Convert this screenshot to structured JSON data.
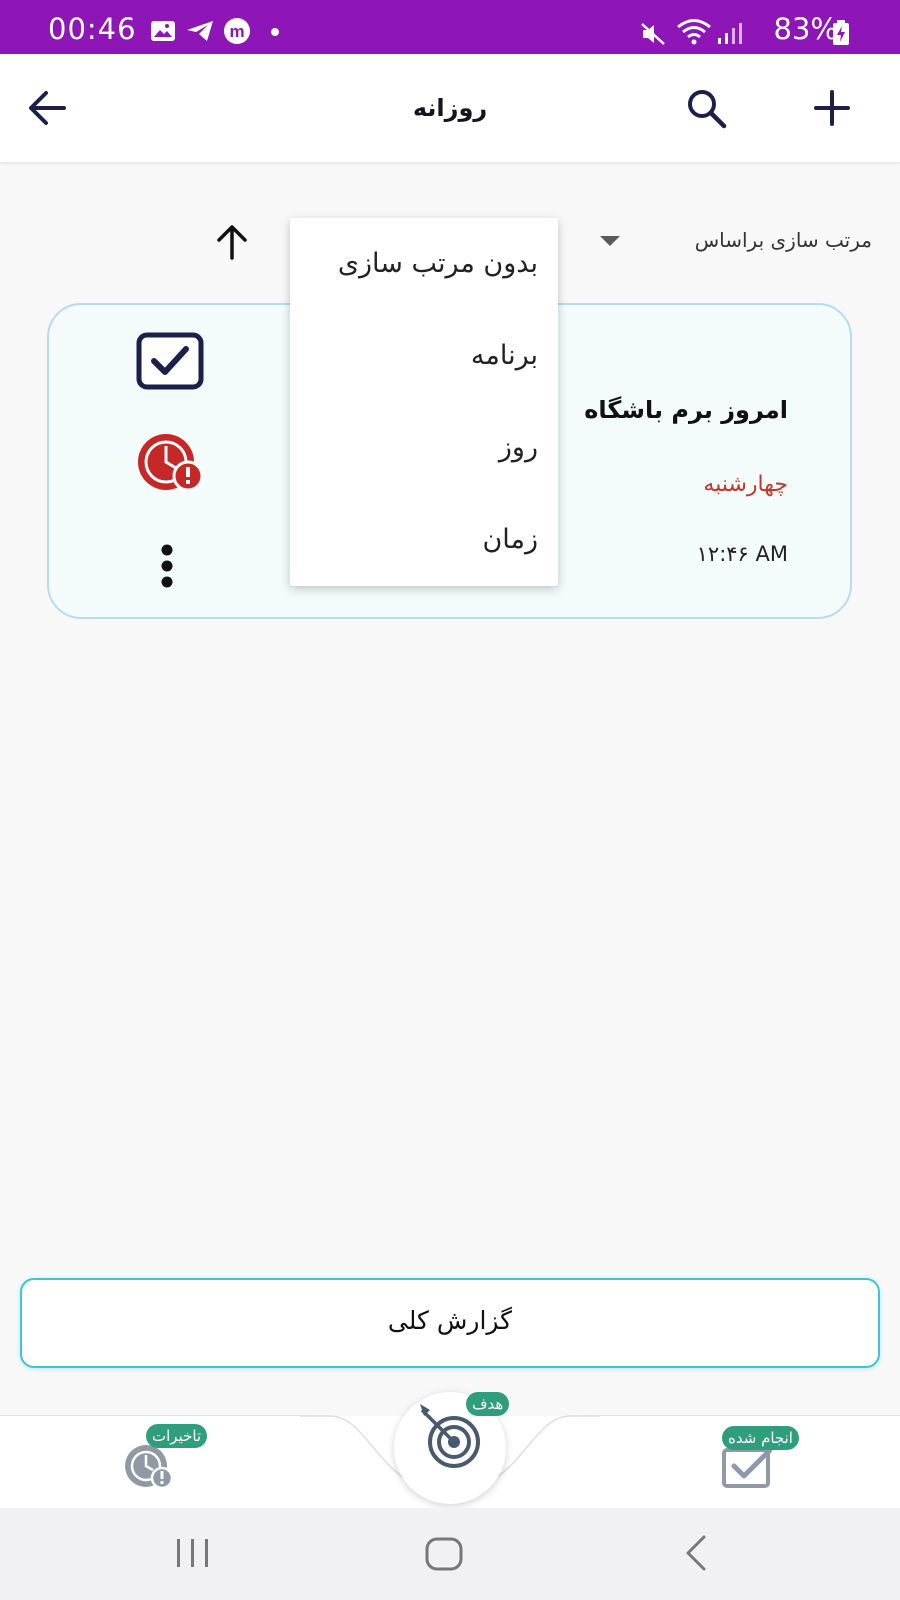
{
  "status_bar": {
    "time": "00:46",
    "battery": "83%"
  },
  "app_bar": {
    "title": "روزانه"
  },
  "sort": {
    "label": "مرتب سازی براساس"
  },
  "sort_menu": {
    "items": [
      "بدون مرتب سازی",
      "برنامه",
      "روز",
      "زمان"
    ]
  },
  "task_card": {
    "title": "امروز برم باشگاه",
    "day": "چهارشنبه",
    "time": "۱۲:۴۶ AM"
  },
  "report_button": {
    "label": "گزارش کلی"
  },
  "bottom_nav": {
    "delays_label": "تاخیرات",
    "goal_label": "هدف",
    "done_label": "انجام شده"
  },
  "colors": {
    "status_bar": "#8e15b6",
    "accent_teal": "#3cc6cf",
    "badge_green": "#2f9e7c",
    "alert_red": "#c62828",
    "navy": "#1b1f4a"
  }
}
